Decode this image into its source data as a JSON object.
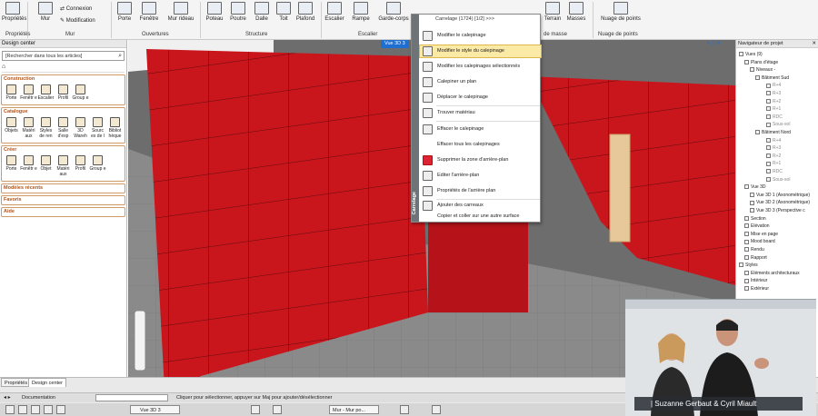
{
  "ribbon": {
    "groups": [
      "Mur",
      "Ouvertures",
      "Structure",
      "Escalier",
      "de masse",
      "Nuage de points"
    ],
    "buttons": [
      "Propriétés",
      "Mur",
      "Porte",
      "Fenêtre",
      "Mur rideau",
      "Poteau",
      "Poutre",
      "Dalle",
      "Toit",
      "Plafond",
      "Escalier",
      "Rampe",
      "Garde-corps",
      "Terrain",
      "Masses",
      "Nuage de points"
    ],
    "connexion": "Connexion",
    "modification": "Modification",
    "properties_group": "Propriétés"
  },
  "design_center": {
    "title": "Design center",
    "search_placeholder": "[Rechercher dans tous les articles]",
    "sections": [
      {
        "title": "Construction",
        "items": [
          "Porte",
          "Fenêtr e",
          "Escalier",
          "Profil",
          "Group e"
        ]
      },
      {
        "title": "Catalogue",
        "items": [
          "Objets",
          "Matéri aux",
          "Styles de ren",
          "Salle d'exp",
          "3D Wareh",
          "Sourc es de l",
          "Bibliot hèque"
        ]
      },
      {
        "title": "Créer",
        "items": [
          "Porte",
          "Fenêtr e",
          "Objet",
          "Matéri aux",
          "Profil",
          "Group e"
        ]
      }
    ],
    "collapsed": [
      "Modèles récents",
      "Favoris",
      "Aide"
    ]
  },
  "viewport": {
    "tab": "Vue 3D 3",
    "wall_color": "#c9161d"
  },
  "context_menu": {
    "side_label": "Carrelage",
    "header": "Carrelage (1724) [1/2] >>>",
    "items": [
      "Modifier le calepinage",
      "Modifier le style du calepinage",
      "Modifier les calepinages sélectionnés",
      "Calepiner un plan",
      "Déplacer le calepinage",
      "Trouver matériau",
      "Effacer le calepinage",
      "Effacer tous les calepinages",
      "Supprimer la zone d'arrière-plan",
      "Editer l'arrière-plan",
      "Propriétés de l'arrière plan",
      "Ajouter des carreaux",
      "Copier et coller sur une autre surface"
    ],
    "highlighted": "Modifier le style du calepinage"
  },
  "navigator": {
    "title": "Navigateur de projet",
    "tree": [
      "Vues (9)",
      "Plans d'étage",
      "Niveaux -",
      "Bâtiment Sud",
      "R+4",
      "R+3",
      "R+2",
      "R+1",
      "RDC",
      "Sous-sol",
      "Bâtiment Nord",
      "R+4",
      "R+3",
      "R+2",
      "R+1",
      "RDC",
      "Sous-sol",
      "Vue 3D",
      "Vue 3D 1 (Axonométrique)",
      "Vue 3D 2 (Axonométrique)",
      "Vue 3D 3 (Perspective c",
      "Section",
      "Elévation",
      "Mise en page",
      "Mood board",
      "Rendu",
      "Rapport",
      "Styles",
      "Eléments architecturaux",
      "Intérieur",
      "Extérieur"
    ]
  },
  "bottom": {
    "tabs": [
      "Propriétés",
      "Design center"
    ],
    "documentation": "Documentation",
    "status": "Cliquer pour sélectionner, appuyer sur Maj pour ajouter/désélectionner",
    "view_select": "Vue 3D 3",
    "wall_select": "Mur - Mur po..."
  },
  "webcam": {
    "caption": "| Suzanne Gerbaut & Cyril Miault"
  }
}
